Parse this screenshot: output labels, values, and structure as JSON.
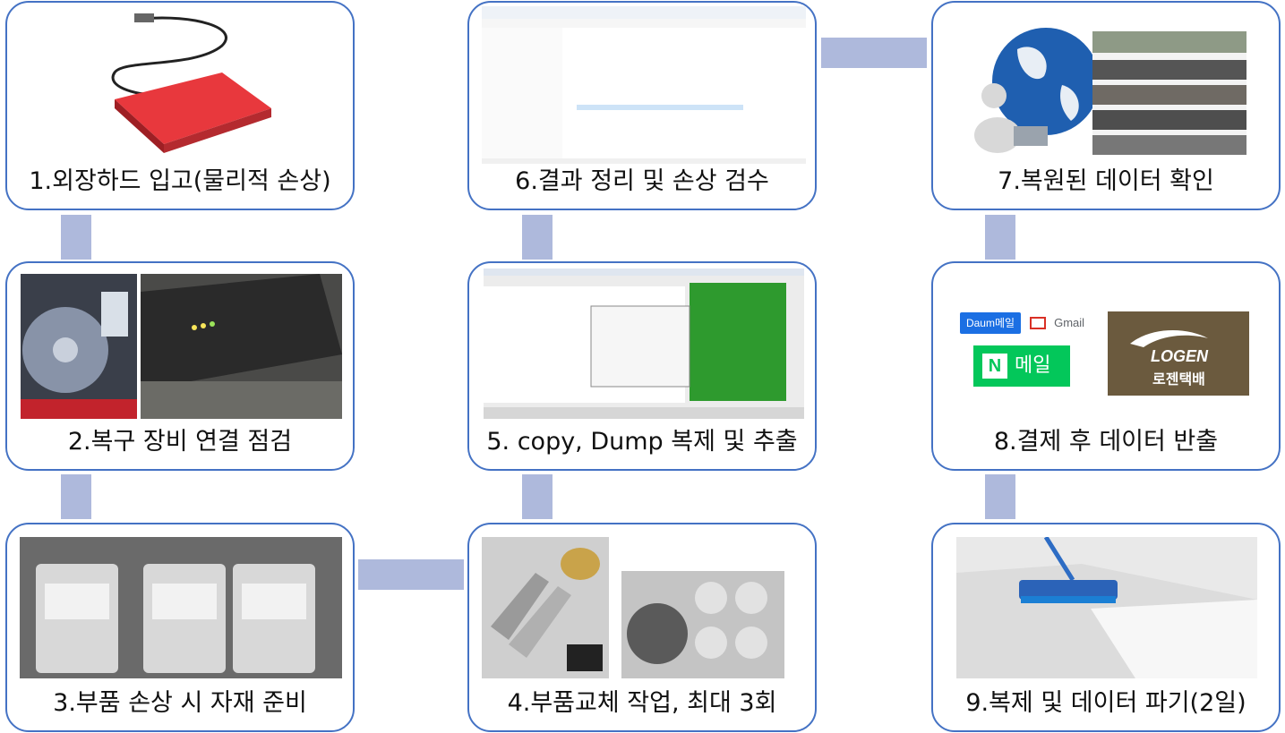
{
  "steps": [
    {
      "label": "1.외장하드 입고(물리적 손상)"
    },
    {
      "label": "2.복구 장비 연결 점검"
    },
    {
      "label": "3.부품 손상 시 자재 준비"
    },
    {
      "label": "4.부품교체 작업, 최대 3회"
    },
    {
      "label": "5. copy, Dump 복제 및 추출"
    },
    {
      "label": "6.결과 정리 및 손상 검수"
    },
    {
      "label": "7.복원된 데이터 확인"
    },
    {
      "label": "8.결제 후 데이터 반출"
    },
    {
      "label": "9.복제 및 데이터 파기(2일)"
    }
  ],
  "logos": {
    "daum": "Daum메일",
    "gmail": "Gmail",
    "naver_n": "N",
    "naver_mail": "메일",
    "logen_en": "LOGEN",
    "logen_ko": "로젠택배"
  },
  "colors": {
    "border": "#4472c4",
    "connector": "#aeb9dc",
    "naver": "#03c75a",
    "logen": "#6b5a3e"
  }
}
